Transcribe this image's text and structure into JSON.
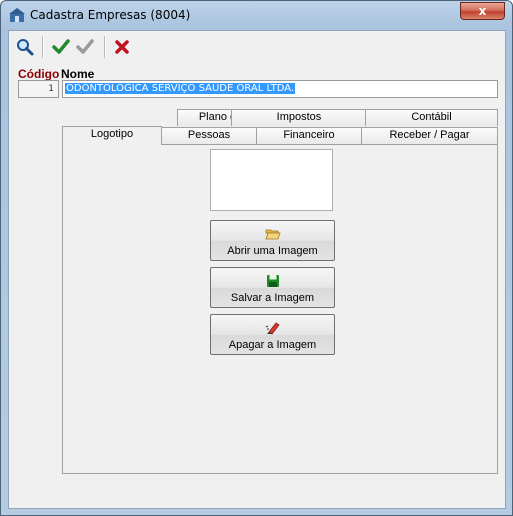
{
  "window": {
    "title": "Cadastra Empresas (8004)",
    "close_label": "x"
  },
  "toolbar": {
    "search_icon": "search-icon",
    "confirm_icon": "checkmark-green-icon",
    "confirm_disabled_icon": "checkmark-gray-icon",
    "cancel_icon": "red-x-icon"
  },
  "form": {
    "codigo_label": "Código",
    "nome_label": "Nome",
    "codigo_value": "1",
    "nome_value": "ODONTOLÓGICA SERVIÇO SAÚDE ORAL LTDA."
  },
  "tabs": {
    "row1": [
      "Plano de Saúde",
      "Impostos",
      "Contábil"
    ],
    "row2": [
      "Logotipo",
      "Pessoas",
      "Financeiro",
      "Receber / Pagar"
    ],
    "active": "Logotipo"
  },
  "logo_panel": {
    "open_label": "Abrir uma Imagem",
    "save_label": "Salvar a Imagem",
    "delete_label": "Apagar a Imagem"
  },
  "colors": {
    "codigo_label": "#8b0000",
    "selection": "#3399ff",
    "close_button": "#c0422e"
  }
}
